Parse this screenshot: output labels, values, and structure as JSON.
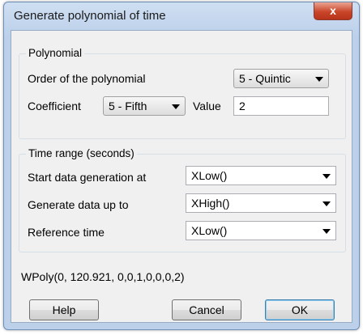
{
  "window": {
    "title": "Generate polynomial of time",
    "close_label": "x"
  },
  "polynomial": {
    "group_title": "Polynomial",
    "order_label": "Order of the polynomial",
    "order_value": "5 - Quintic",
    "coefficient_label": "Coefficient",
    "coefficient_value": "5 - Fifth",
    "value_label": "Value",
    "value": "2"
  },
  "time_range": {
    "group_title": "Time range (seconds)",
    "start_label": "Start data generation at",
    "start_value": "XLow()",
    "upto_label": "Generate data up to",
    "upto_value": "XHigh()",
    "reference_label": "Reference time",
    "reference_value": "XLow()"
  },
  "formula": "WPoly(0, 120.921, 0,0,1,0,0,0,2)",
  "buttons": {
    "help": "Help",
    "cancel": "Cancel",
    "ok": "OK"
  }
}
